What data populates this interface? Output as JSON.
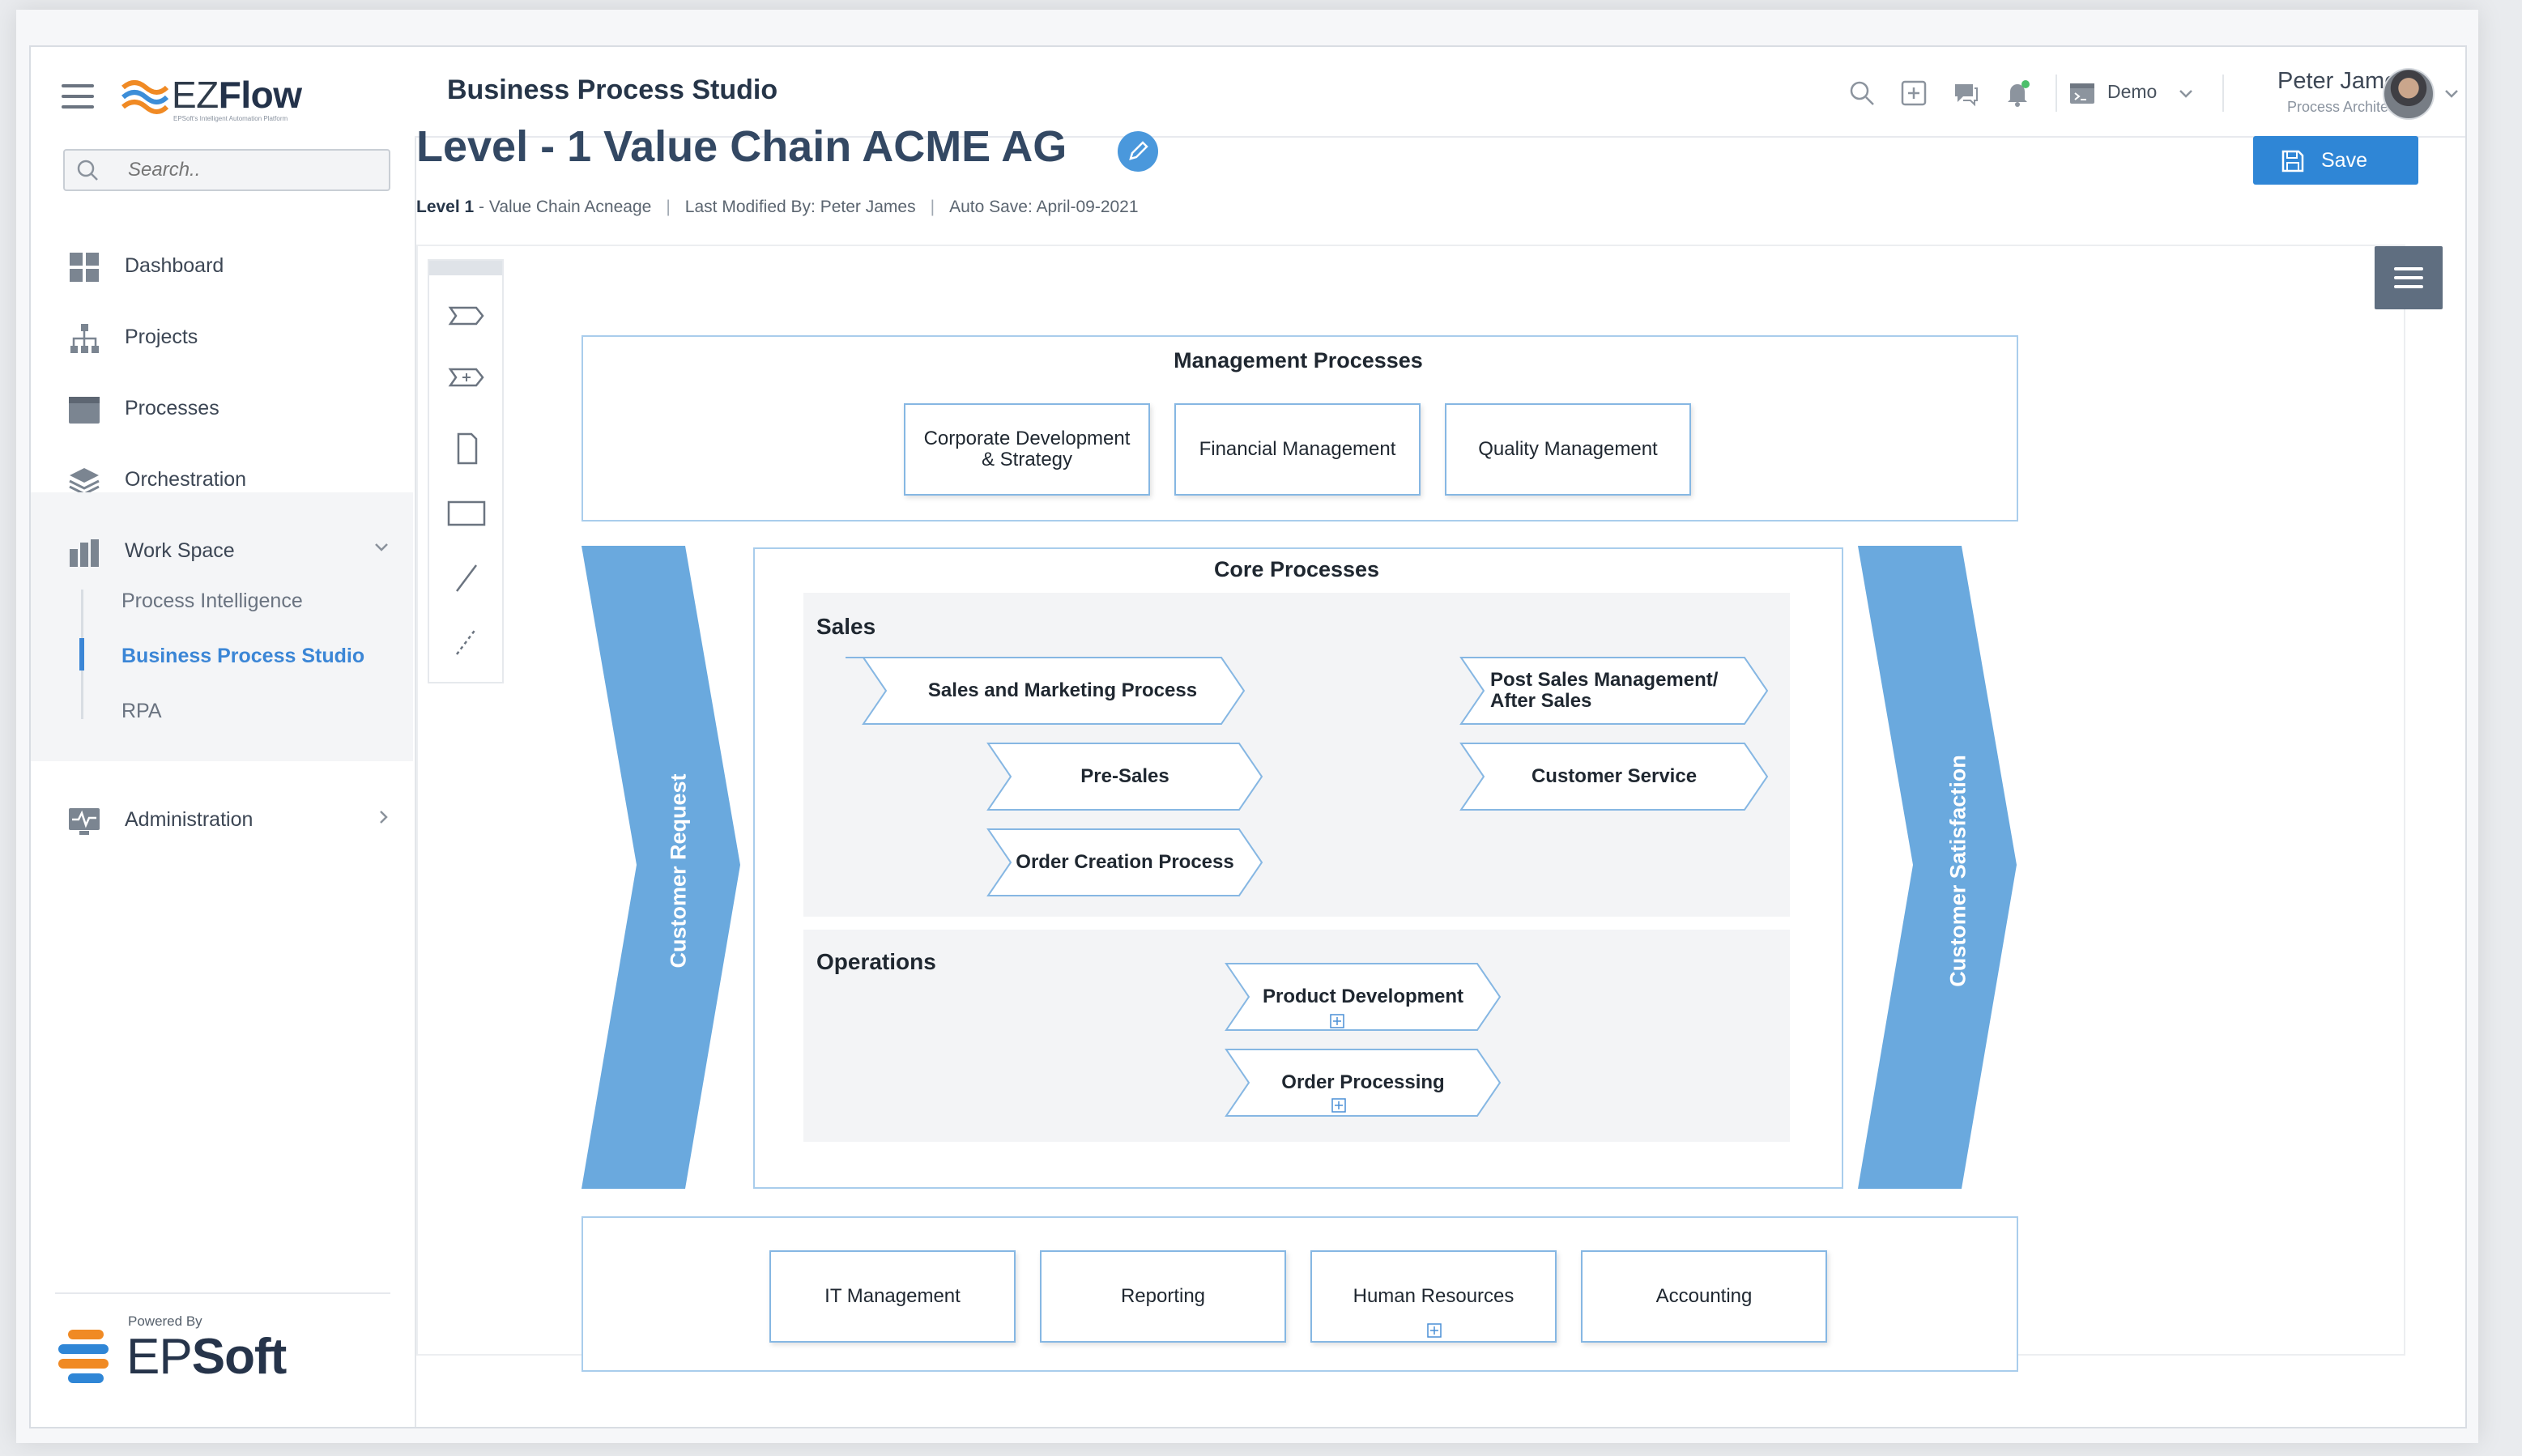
{
  "app": {
    "logo": {
      "name_light": "EZ",
      "name_bold": "Flow",
      "tagline": "EPSoft's Intelligent Automation Platform"
    },
    "title": "Business Process Studio"
  },
  "sidebar": {
    "search_placeholder": "Search..",
    "items": [
      {
        "label": "Dashboard",
        "icon": "dashboard-grid-icon"
      },
      {
        "label": "Projects",
        "icon": "hierarchy-icon"
      },
      {
        "label": "Processes",
        "icon": "browser-window-icon"
      },
      {
        "label": "Orchestration",
        "icon": "layers-icon"
      },
      {
        "label": "Work Space",
        "icon": "workspace-icon"
      },
      {
        "label": "Administration",
        "icon": "monitor-pulse-icon"
      }
    ],
    "workspace_sub": [
      {
        "label": "Process Intelligence"
      },
      {
        "label": "Business Process Studio"
      },
      {
        "label": "RPA"
      }
    ],
    "powered_by": "Powered By",
    "vendor_light": "EP",
    "vendor_bold": "Soft"
  },
  "header": {
    "env_label": "Demo",
    "user_name": "Peter James",
    "user_role": "Process Architect",
    "icons": [
      "search-icon",
      "add-square-icon",
      "chat-icon",
      "bell-icon",
      "terminal-icon"
    ]
  },
  "page": {
    "title": "Level - 1 Value Chain ACME AG",
    "meta_level": "Level 1",
    "meta_level_rest": " - Value Chain Acneage",
    "meta_modified": "Last Modified By: Peter James",
    "meta_autosave": "Auto Save: April-09-2021",
    "save_label": "Save"
  },
  "diagram": {
    "management": {
      "title": "Management Processes",
      "boxes": [
        "Corporate Development & Strategy",
        "Financial Management",
        "Quality Management"
      ]
    },
    "customer_request": "Customer Request",
    "customer_satisfaction": "Customer Satisfaction",
    "core": {
      "title": "Core Processes",
      "sales": {
        "title": "Sales",
        "items": [
          "Sales and Marketing Process",
          "Pre-Sales",
          "Order Creation Process",
          "Post Sales Management/ After Sales",
          "Customer Service"
        ]
      },
      "operations": {
        "title": "Operations",
        "items": [
          "Product Development",
          "Order Processing"
        ]
      }
    },
    "support": {
      "boxes": [
        "IT Management",
        "Reporting",
        "Human Resources",
        "Accounting"
      ]
    },
    "colors": {
      "accent": "#2f86d6",
      "arrow": "#6aa9de",
      "border": "#a9cdec"
    }
  }
}
